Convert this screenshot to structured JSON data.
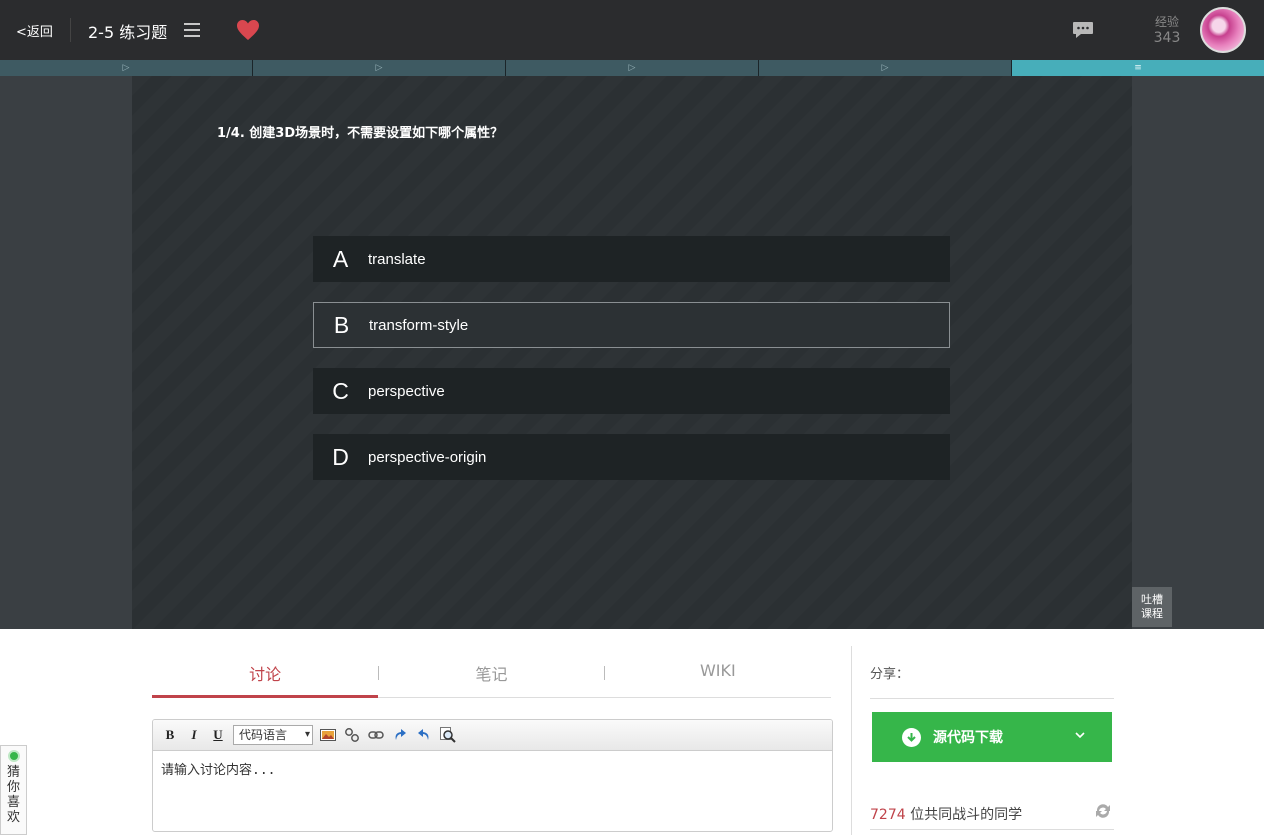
{
  "header": {
    "back_label": "<返回",
    "title": "2-5 练习题",
    "exp_label": "经验",
    "exp_value": "343"
  },
  "steps": [
    "▷",
    "▷",
    "▷",
    "▷",
    "≡"
  ],
  "quiz": {
    "question": "1/4. 创建3D场景时，不需要设置如下哪个属性？",
    "options": [
      {
        "letter": "A",
        "text": "translate"
      },
      {
        "letter": "B",
        "text": "transform-style"
      },
      {
        "letter": "C",
        "text": "perspective"
      },
      {
        "letter": "D",
        "text": "perspective-origin"
      }
    ],
    "tucao_label_1": "吐槽",
    "tucao_label_2": "课程"
  },
  "tabs": [
    {
      "label": "讨论"
    },
    {
      "label": "笔记"
    },
    {
      "label": "WIKI"
    }
  ],
  "editor": {
    "bold": "B",
    "italic": "I",
    "underline": "U",
    "code_lang": "代码语言",
    "placeholder": "请输入讨论内容..."
  },
  "sidebar": {
    "share_label": "分享：",
    "download_label": "源代码下载",
    "peers_count": "7274",
    "peers_text": "位共同战斗的同学"
  },
  "guess": {
    "chars": [
      "猜",
      "你",
      "喜",
      "欢"
    ]
  },
  "colors": {
    "accent": "#c0434a",
    "active_step": "#47aeba",
    "download_green": "#36b64a",
    "heart": "#d9474f"
  }
}
